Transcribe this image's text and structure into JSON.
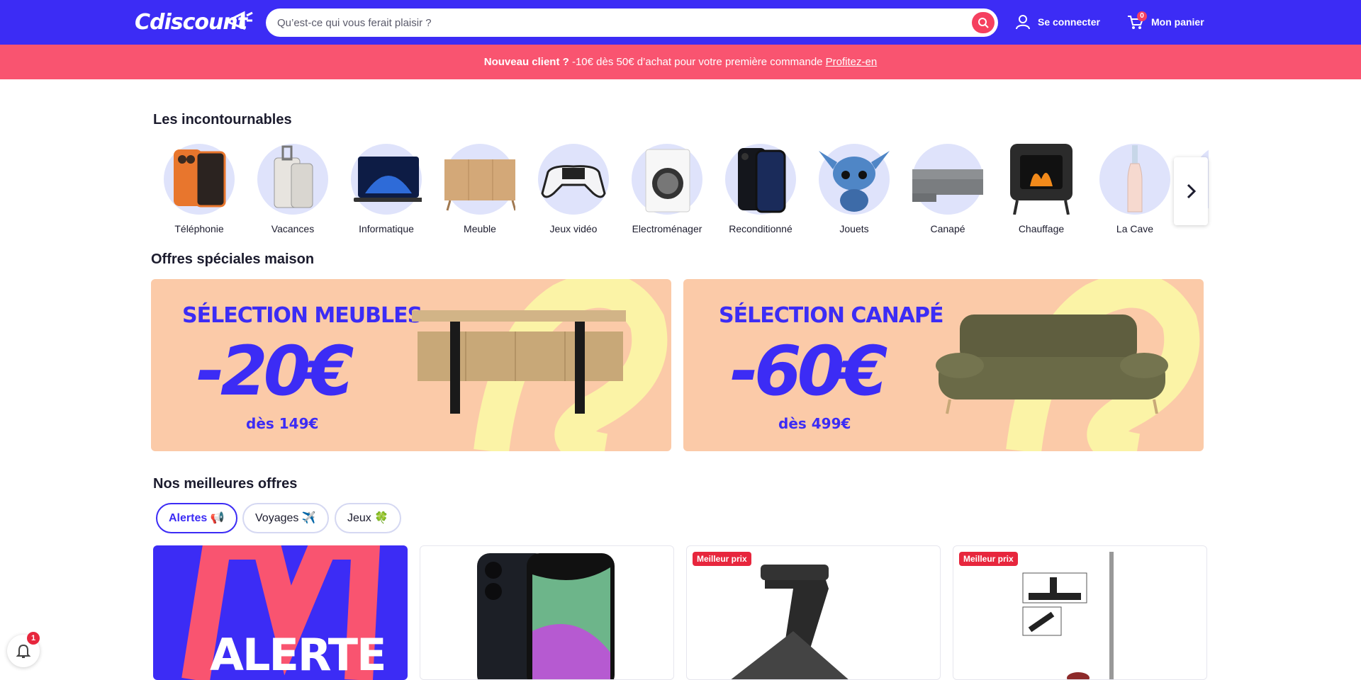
{
  "header": {
    "logo_text": "Cdiscount",
    "search_placeholder": "Qu’est-ce qui vous ferait plaisir ?",
    "login_label": "Se connecter",
    "cart_label": "Mon panier",
    "cart_count": "0",
    "brand_color": "#3c2cf5",
    "accent_color": "#f5405f"
  },
  "promo": {
    "bold": "Nouveau client ?",
    "text": " -10€ dès 50€ d’achat pour votre première commande ",
    "link": "Profitez-en"
  },
  "incontournables": {
    "title": "Les incontournables",
    "items": [
      {
        "label": "Téléphonie",
        "icon": "phone-icon"
      },
      {
        "label": "Vacances",
        "icon": "suitcase-icon"
      },
      {
        "label": "Informatique",
        "icon": "laptop-icon"
      },
      {
        "label": "Meuble",
        "icon": "sideboard-icon"
      },
      {
        "label": "Jeux vidéo",
        "icon": "gamepad-icon"
      },
      {
        "label": "Electroménager",
        "icon": "washing-machine-icon"
      },
      {
        "label": "Reconditionné",
        "icon": "smartphone-icon"
      },
      {
        "label": "Jouets",
        "icon": "plush-toy-icon"
      },
      {
        "label": "Canapé",
        "icon": "sofa-icon"
      },
      {
        "label": "Chauffage",
        "icon": "stove-icon"
      },
      {
        "label": "La Cave",
        "icon": "wine-bottle-icon"
      }
    ]
  },
  "offres": {
    "title": "Offres spéciales maison",
    "banners": [
      {
        "heading": "SÉLECTION MEUBLES",
        "discount": "-20€",
        "condition": "dès 149€",
        "image": "sideboard-image"
      },
      {
        "heading": "SÉLECTION CANAPÉ",
        "discount": "-60€",
        "condition": "dès 499€",
        "image": "sofa-image"
      }
    ]
  },
  "meilleures": {
    "title": "Nos meilleures offres",
    "tabs": [
      {
        "label": "Alertes 📢",
        "active": true
      },
      {
        "label": "Voyages ✈️",
        "active": false
      },
      {
        "label": "Jeux 🍀",
        "active": false
      }
    ],
    "cards": [
      {
        "badge": "",
        "text": "ALERTE",
        "image": "alert-banner"
      },
      {
        "badge": "",
        "image": "iphone-image"
      },
      {
        "badge": "Meilleur prix",
        "image": "treadmill-image"
      },
      {
        "badge": "Meilleur prix",
        "image": "vacuum-image"
      }
    ]
  },
  "notifications": {
    "count": "1"
  }
}
